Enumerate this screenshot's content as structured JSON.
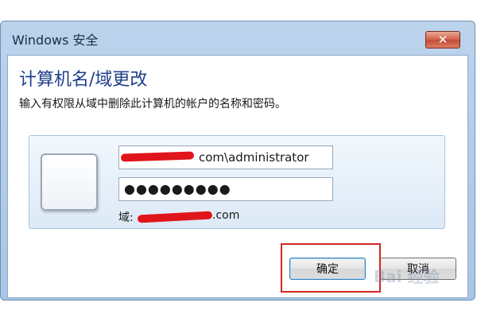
{
  "window": {
    "title": "Windows 安全",
    "close_label": "✕"
  },
  "dialog": {
    "heading": "计算机名/域更改",
    "instruction": "输入有权限从域中删除此计算机的帐户的名称和密码。"
  },
  "credentials": {
    "username_visible_part": "com\\administrator",
    "password_mask": "●●●●●●●●●",
    "domain_label": "域:",
    "domain_visible_part": ".com"
  },
  "buttons": {
    "ok_label": "确定",
    "cancel_label": "取消"
  },
  "watermark": {
    "text": "Bai 经验"
  },
  "colors": {
    "heading": "#1f3f8a",
    "highlight_box": "#d4271f",
    "redaction": "#e0151a"
  }
}
